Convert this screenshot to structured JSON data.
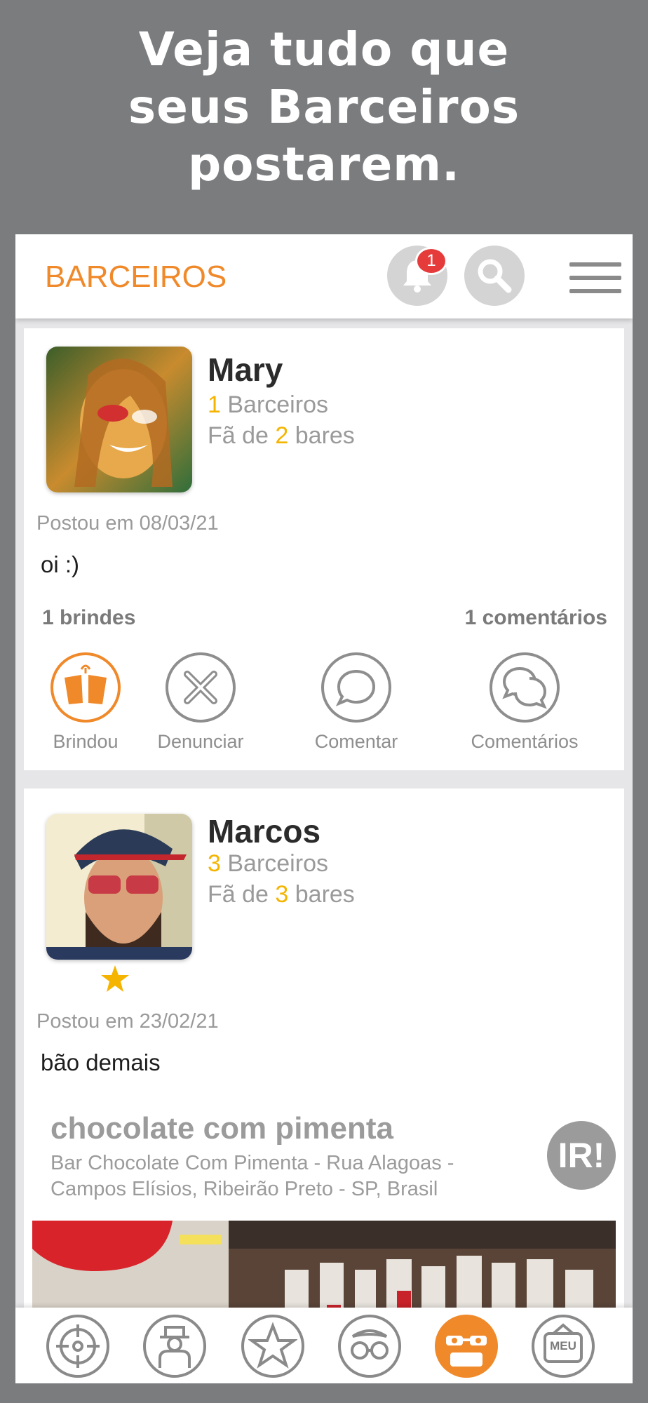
{
  "promo": {
    "line1": "Veja tudo que",
    "line2": "seus Barceiros",
    "line3": "postarem."
  },
  "header": {
    "title": "BARCEIROS",
    "notification_count": "1"
  },
  "posts": [
    {
      "name": "Mary",
      "barceiros_count": "1",
      "barceiros_label": " Barceiros",
      "fan_prefix": "Fã de ",
      "fan_count": "2",
      "fan_suffix": " bares",
      "posted": "Postou em 08/03/21",
      "text": "oi :)",
      "brindes": "1 brindes",
      "comentarios": "1 comentários",
      "actions": {
        "toast": "Brindou",
        "report": "Denunciar",
        "comment": "Comentar",
        "comments": "Comentários"
      }
    },
    {
      "name": "Marcos",
      "barceiros_count": "3",
      "barceiros_label": " Barceiros",
      "fan_prefix": "Fã de ",
      "fan_count": "3",
      "fan_suffix": " bares",
      "posted": "Postou em 23/02/21",
      "text": "bão demais",
      "place": {
        "title": "chocolate com pimenta",
        "address": "Bar Chocolate Com Pimenta - Rua Alagoas - Campos Elísios, Ribeirão Preto - SP, Brasil",
        "go_label": "IR!"
      }
    }
  ],
  "bottom_nav": {
    "meu_label": "MEU"
  },
  "colors": {
    "accent": "#f0892a",
    "highlight": "#f5b400",
    "badge": "#e63b3b",
    "frame": "#7b7c7e"
  }
}
